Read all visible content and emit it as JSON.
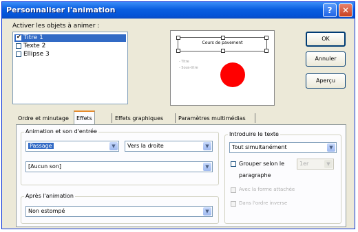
{
  "window": {
    "title": "Personnaliser l'animation",
    "help_glyph": "?",
    "close_glyph": "✕"
  },
  "objects": {
    "label": "Activer les objets à animer :",
    "items": [
      {
        "label": "Titre 1",
        "checked": true,
        "selected": true
      },
      {
        "label": "Texte 2",
        "checked": false,
        "selected": false
      },
      {
        "label": "Ellipse 3",
        "checked": false,
        "selected": false
      }
    ]
  },
  "preview": {
    "title_text": "Cours de pavement",
    "bullet1": "- Titre",
    "bullet2": "- Sous-titre",
    "circle_color": "#ff0000"
  },
  "buttons": {
    "ok": "OK",
    "cancel": "Annuler",
    "preview": "Aperçu"
  },
  "tabs": [
    {
      "label": "Ordre et minutage"
    },
    {
      "label": "Effets",
      "active": true
    },
    {
      "label": "Effets graphiques"
    },
    {
      "label": "Paramètres multimédias"
    }
  ],
  "animation_group": {
    "label": "Animation et son d'entrée",
    "effect": "Passage",
    "direction": "Vers la droite",
    "sound": "[Aucun son]"
  },
  "after_group": {
    "label": "Après l'animation",
    "value": "Non estompé"
  },
  "text_group": {
    "label": "Introduire le texte",
    "mode": "Tout simultanément",
    "group_by_label": "Grouper selon le",
    "group_by_value": "1er",
    "group_by_label2": "paragraphe",
    "opt_attached": "Avec la forme attachée",
    "opt_reverse": "Dans l'ordre inverse"
  }
}
